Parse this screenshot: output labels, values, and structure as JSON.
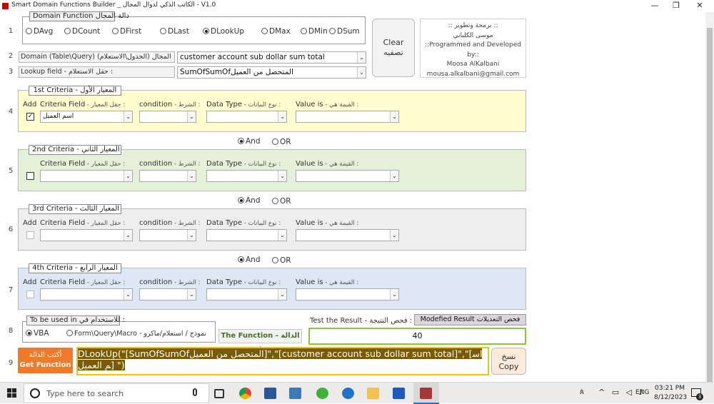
{
  "window": {
    "title": "Smart Domain Functions Builder _ الكاتب الذكي لدوال المجال  -  V1.0",
    "minimize": "—",
    "maximize": "❐",
    "close": "✕"
  },
  "rows": [
    "1",
    "2",
    "3",
    "4",
    "5",
    "6",
    "7",
    "8",
    "9"
  ],
  "domain_function": {
    "legend": "Domain Function  دالة المجال",
    "options": [
      "DAvg",
      "DCount",
      "DFirst",
      "DLast",
      "DLookUp",
      "DMax",
      "DMin",
      "DSum"
    ],
    "selected": "DLookUp"
  },
  "clear_button": {
    "en": "Clear",
    "ar": "تصفيه"
  },
  "credits": {
    "ar_line1": ":: برمجة وتطوير ::",
    "ar_line2": "موسى الكلباني",
    "en_line": "::Programmed and Developed by::",
    "name": "Moosa AlKalbani",
    "email": "mousa.alkalbani@gmail.com"
  },
  "domain": {
    "label": "Domain (Table\\Query) المجال (الجدول\\الاستعلام) :",
    "value": "customer account sub dollar sum total"
  },
  "lookup": {
    "label": "Lookup field  -  حقل الاستعلام :",
    "value": "SumOfSumOfالمتحصل من العميل"
  },
  "criteria_labels": {
    "add": "Add",
    "field_en": "Criteria Field",
    "field_ar": " - حقل المعيار :",
    "cond_en": "condition",
    "cond_ar": " - الشرط :",
    "type_en": "Data Type",
    "type_ar": " - نوع البيانات :",
    "value_en": "Value is",
    "value_ar": " - القيمة هي :"
  },
  "criteria": [
    {
      "legend": "1st Criteria  -  المعيار الأول",
      "checked": true,
      "field": "اسم العميل",
      "color": "#fffdd0"
    },
    {
      "legend": "2nd Criteria  -  المعيار الثاني",
      "checked": false,
      "field": "",
      "color": "#e5f0d9"
    },
    {
      "legend": "3rd Criteria  -  المعيار الثالث",
      "checked": false,
      "field": "",
      "color": "#eeeeee"
    },
    {
      "legend": "4th Criteria  -  المعيار الرابع",
      "checked": false,
      "field": "",
      "color": "#dde8f4"
    }
  ],
  "connectors": [
    {
      "and": "And",
      "or": "OR",
      "selected": "And"
    },
    {
      "and": "And",
      "or": "OR",
      "selected": "And"
    },
    {
      "and": "And",
      "or": "OR",
      "selected": "And"
    }
  ],
  "used_in": {
    "legend": "To be used in  للاستخدام في :",
    "options": [
      "VBA",
      "Form\\Query\\Macro - نموذج / استعلام/ماكرو"
    ],
    "selected": "VBA"
  },
  "function_label": "The Function - الدالة :",
  "test": {
    "label": "Test the Result  -  فحص النتيجة :",
    "button": "Modefied Result  فحص التعديلات",
    "result": "40"
  },
  "get_function": {
    "ar": "أكتب الدالة",
    "en": "Get Function"
  },
  "function_text": "DLookUp(\"[SumOfSumOfالمتحصل من العميل]\",\"[customer account sub dollar sum total]\",\"[اسم العميل] \")",
  "copy_button": {
    "ar": "نسخ",
    "en": "Copy"
  },
  "taskbar": {
    "search_placeholder": "Type here to search",
    "lang": "ENG",
    "time": "03:21 PM",
    "date": "8/12/2023",
    "notif_count": "3"
  }
}
